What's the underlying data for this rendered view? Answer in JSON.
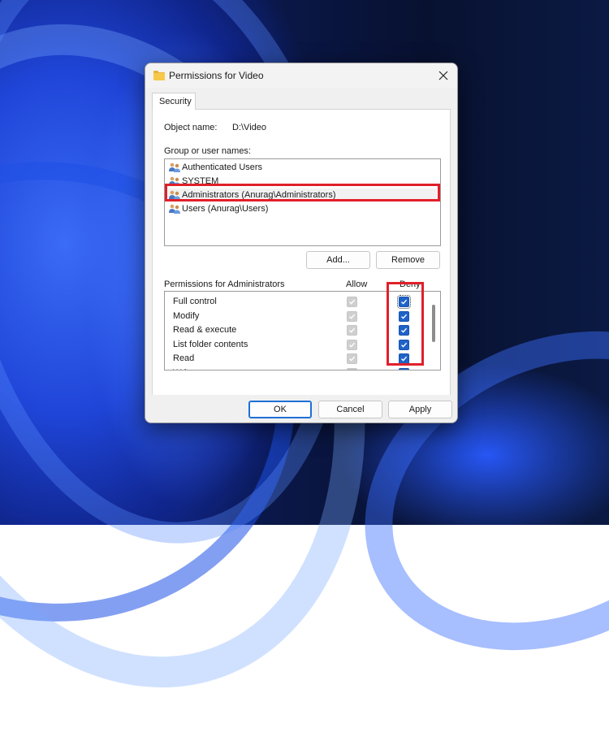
{
  "dialog": {
    "title": "Permissions for Video",
    "tab": "Security",
    "object_name_label": "Object name:",
    "object_name_value": "D:\\Video",
    "group_label": "Group or user names:",
    "users": [
      {
        "name": "Authenticated Users",
        "selected": false
      },
      {
        "name": "SYSTEM",
        "selected": false
      },
      {
        "name": "Administrators (Anurag\\Administrators)",
        "selected": true
      },
      {
        "name": "Users (Anurag\\Users)",
        "selected": false
      }
    ],
    "add_label": "Add...",
    "remove_label": "Remove",
    "permissions_label": "Permissions for Administrators",
    "allow_header": "Allow",
    "deny_header": "Deny",
    "permissions": [
      {
        "name": "Full control",
        "allow": true,
        "deny": true
      },
      {
        "name": "Modify",
        "allow": true,
        "deny": true
      },
      {
        "name": "Read & execute",
        "allow": true,
        "deny": true
      },
      {
        "name": "List folder contents",
        "allow": true,
        "deny": true
      },
      {
        "name": "Read",
        "allow": true,
        "deny": true
      },
      {
        "name": "Write",
        "allow": true,
        "deny": true
      }
    ],
    "ok_label": "OK",
    "cancel_label": "Cancel",
    "apply_label": "Apply"
  },
  "colors": {
    "highlight": "#e0202a",
    "checkbox_checked": "#1f63c9",
    "checkbox_disabled": "#cfcfcf",
    "primary_button_border": "#1f6fd6"
  },
  "icons": {
    "title": "folder-icon",
    "close": "close-icon",
    "user": "users-group-icon",
    "check": "checkmark-icon"
  }
}
